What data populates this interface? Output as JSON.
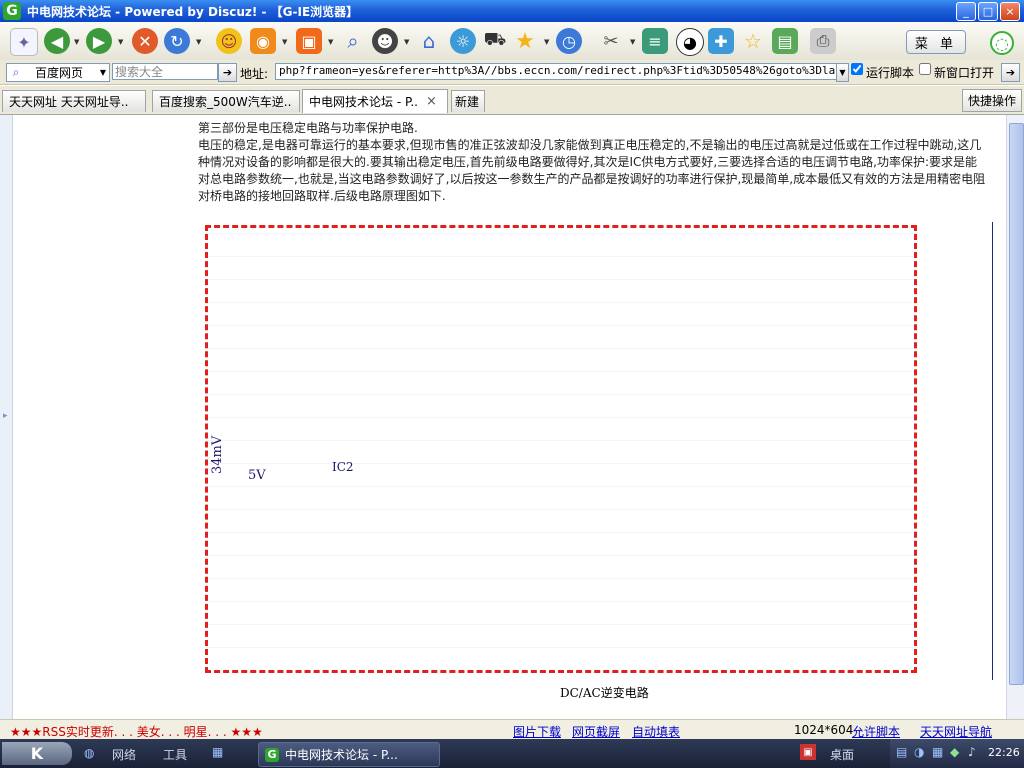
{
  "window": {
    "title": "中电网技术论坛 - Powered by Discuz! - 【G-IE浏览器】",
    "logo": "G",
    "controls": [
      "minimize",
      "maximize",
      "close"
    ]
  },
  "toolbar": {
    "icons": [
      "new-page-icon",
      "back-icon",
      "forward-icon",
      "stop-icon",
      "refresh-icon",
      "smiley-icon",
      "rss-icon",
      "tools-icon",
      "search-icon",
      "qq-icon",
      "home-icon",
      "weather-icon",
      "cart-icon",
      "favorites-icon",
      "history-icon",
      "settings-icon",
      "books-icon",
      "panda-icon",
      "puzzle-icon",
      "star-icon",
      "photo-icon",
      "print-icon"
    ],
    "menu_label": "菜 单"
  },
  "addressbar": {
    "search_engine": "百度网页",
    "search_value": "搜索大全",
    "address_label": "地址:",
    "url": "php?frameon=yes&referer=http%3A//bbs.eccn.com/redirect.php%3Ftid%3D50548%26goto%3Dlastpost",
    "run_script_label": "运行脚本",
    "run_script_checked": true,
    "new_window_label": "新窗口打开",
    "new_window_checked": false
  },
  "tabs": [
    {
      "label": "天天网址 天天网址导.."
    },
    {
      "label": "百度搜索_500W汽车逆.."
    },
    {
      "label": "中电网技术论坛 - P..",
      "active": true
    }
  ],
  "new_tab_label": "新建",
  "quick_action_label": "快捷操作",
  "article": {
    "paragraphs": [
      "第三部份是电压稳定电路与功率保护电路.",
      "电压的稳定,是电器可靠运行的基本要求,但现市售的准正弦波却没几家能做到真正电压稳定的,不是输出的电压过高就是过低或在工作过程中跳动,这几种情况对设备的影响都是很大的.要其输出稳定电压,首先前级电路要做得好,其次是IC供电方式要好,三要选择合适的电压调节电路,功率保护:要求是能对总电路参数统一,也就是,当这电路参数调好了,以后按这一参数生产的产品都是按调好的功率进行保护,现最简单,成本最低又有效的方法是用精密电阻对桥电路的接地回路取样.后级电路原理图如下."
    ]
  },
  "schematic": {
    "caption": "DC/AC逆变电路",
    "labels": {
      "mv": "34mV",
      "vcc": "5V",
      "ic": "IC2"
    }
  },
  "statusbar": {
    "left_text": "★★★RSS实时更新. . . 美女. . . 明星. . . ★★★",
    "links": [
      "图片下载",
      "网页截屏",
      "自动填表"
    ],
    "resolution": "1024*604",
    "allow_script": "允许脚本",
    "nav_link": "天天网址导航"
  },
  "taskbar": {
    "items": [
      "网络",
      "工具"
    ],
    "task_label": "中电网技术论坛 - P...",
    "desktop_label": "桌面",
    "clock": "22:26"
  },
  "colors": {
    "titlebar": "#1f5fd8",
    "schematic_border": "#e0201e",
    "link": "#0000cc"
  }
}
